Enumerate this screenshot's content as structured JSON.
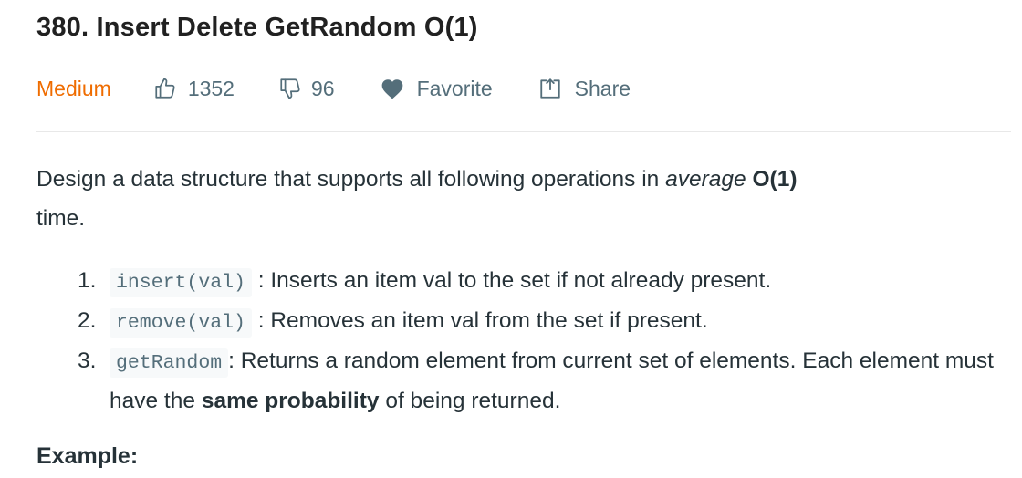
{
  "problem": {
    "title": "380. Insert Delete GetRandom O(1)",
    "difficulty": "Medium",
    "likes": "1352",
    "dislikes": "96",
    "favorite_label": "Favorite",
    "share_label": "Share"
  },
  "description": {
    "intro_before": "Design a data structure that supports all following operations in ",
    "intro_em": "average",
    "intro_bold": "O(1)",
    "intro_after": "time."
  },
  "operations": [
    {
      "number": "1.",
      "code": "insert(val)",
      "text": ": Inserts an item val to the set if not already present."
    },
    {
      "number": "2.",
      "code": "remove(val)",
      "text": ": Removes an item val from the set if present."
    },
    {
      "number": "3.",
      "code": "getRandom",
      "text_before": ": Returns a random element from current set of elements. Each element must have the ",
      "text_bold": "same probability",
      "text_after": " of being returned."
    }
  ],
  "example_heading": "Example:",
  "colors": {
    "difficulty_medium": "#ef6c00",
    "meta_text": "#546e7a",
    "body_text": "#263238",
    "code_bg": "#f7f9fa"
  },
  "icons": [
    "thumbs-up-icon",
    "thumbs-down-icon",
    "heart-icon",
    "share-icon"
  ]
}
